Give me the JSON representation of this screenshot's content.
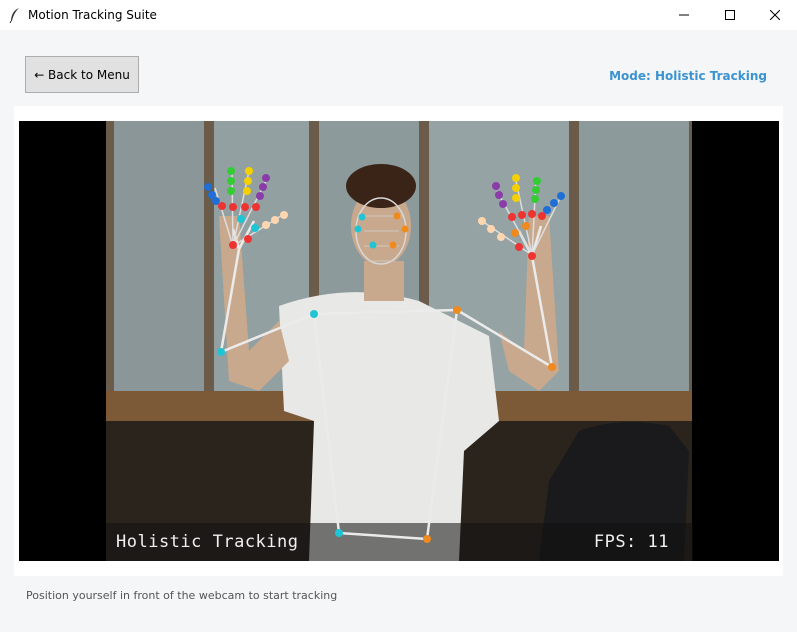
{
  "window": {
    "title": "Motion Tracking Suite",
    "icon": "feather-icon",
    "controls": [
      "minimize-icon",
      "maximize-icon",
      "close-icon"
    ]
  },
  "toolbar": {
    "back_label": "← Back to Menu",
    "mode_label": "Mode: Holistic Tracking"
  },
  "video": {
    "overlay_title": "Holistic Tracking",
    "fps_text": "FPS: 11"
  },
  "status_text": "Position yourself in front of the webcam to start tracking",
  "colors": {
    "accent": "#3b93d1",
    "landmark_cyan": "#1fc5d4",
    "landmark_orange": "#f08a1c",
    "finger_red": "#ee3333",
    "finger_yellow": "#f5d000",
    "finger_green": "#33cc33",
    "finger_blue": "#1f6fd6",
    "finger_purple": "#8a3da8",
    "finger_peach": "#ffd6b0"
  }
}
